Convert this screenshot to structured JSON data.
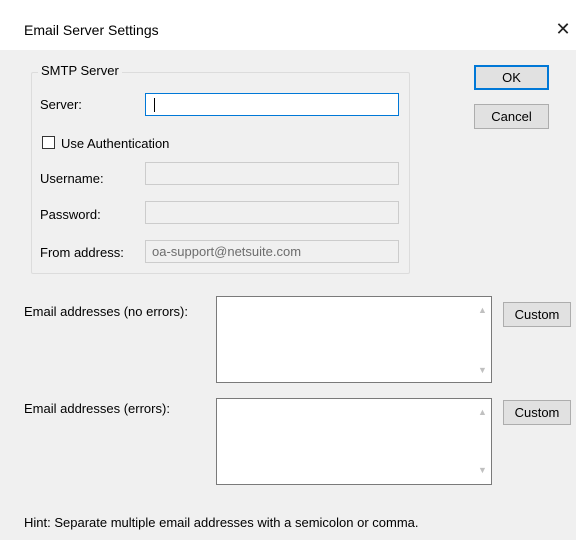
{
  "window": {
    "title": "Email Server Settings",
    "close_glyph": "✕"
  },
  "smtp": {
    "group_label": "SMTP Server",
    "server_label": "Server:",
    "server_value": "",
    "use_auth_label": "Use Authentication",
    "use_auth_checked": false,
    "username_label": "Username:",
    "username_value": "",
    "password_label": "Password:",
    "password_value": "",
    "from_label": "From address:",
    "from_value": "oa-support@netsuite.com"
  },
  "buttons": {
    "ok": "OK",
    "cancel": "Cancel"
  },
  "emails": {
    "no_errors_label": "Email addresses (no errors):",
    "no_errors_value": "",
    "errors_label": "Email addresses (errors):",
    "errors_value": "",
    "custom_label": "Custom"
  },
  "hint": "Hint: Separate multiple email addresses with a semicolon or comma.",
  "icons": {
    "scroll_up": "▲",
    "scroll_down": "▼"
  },
  "colors": {
    "focus_border": "#0078d7",
    "dialog_bg": "#f0f0f0"
  }
}
